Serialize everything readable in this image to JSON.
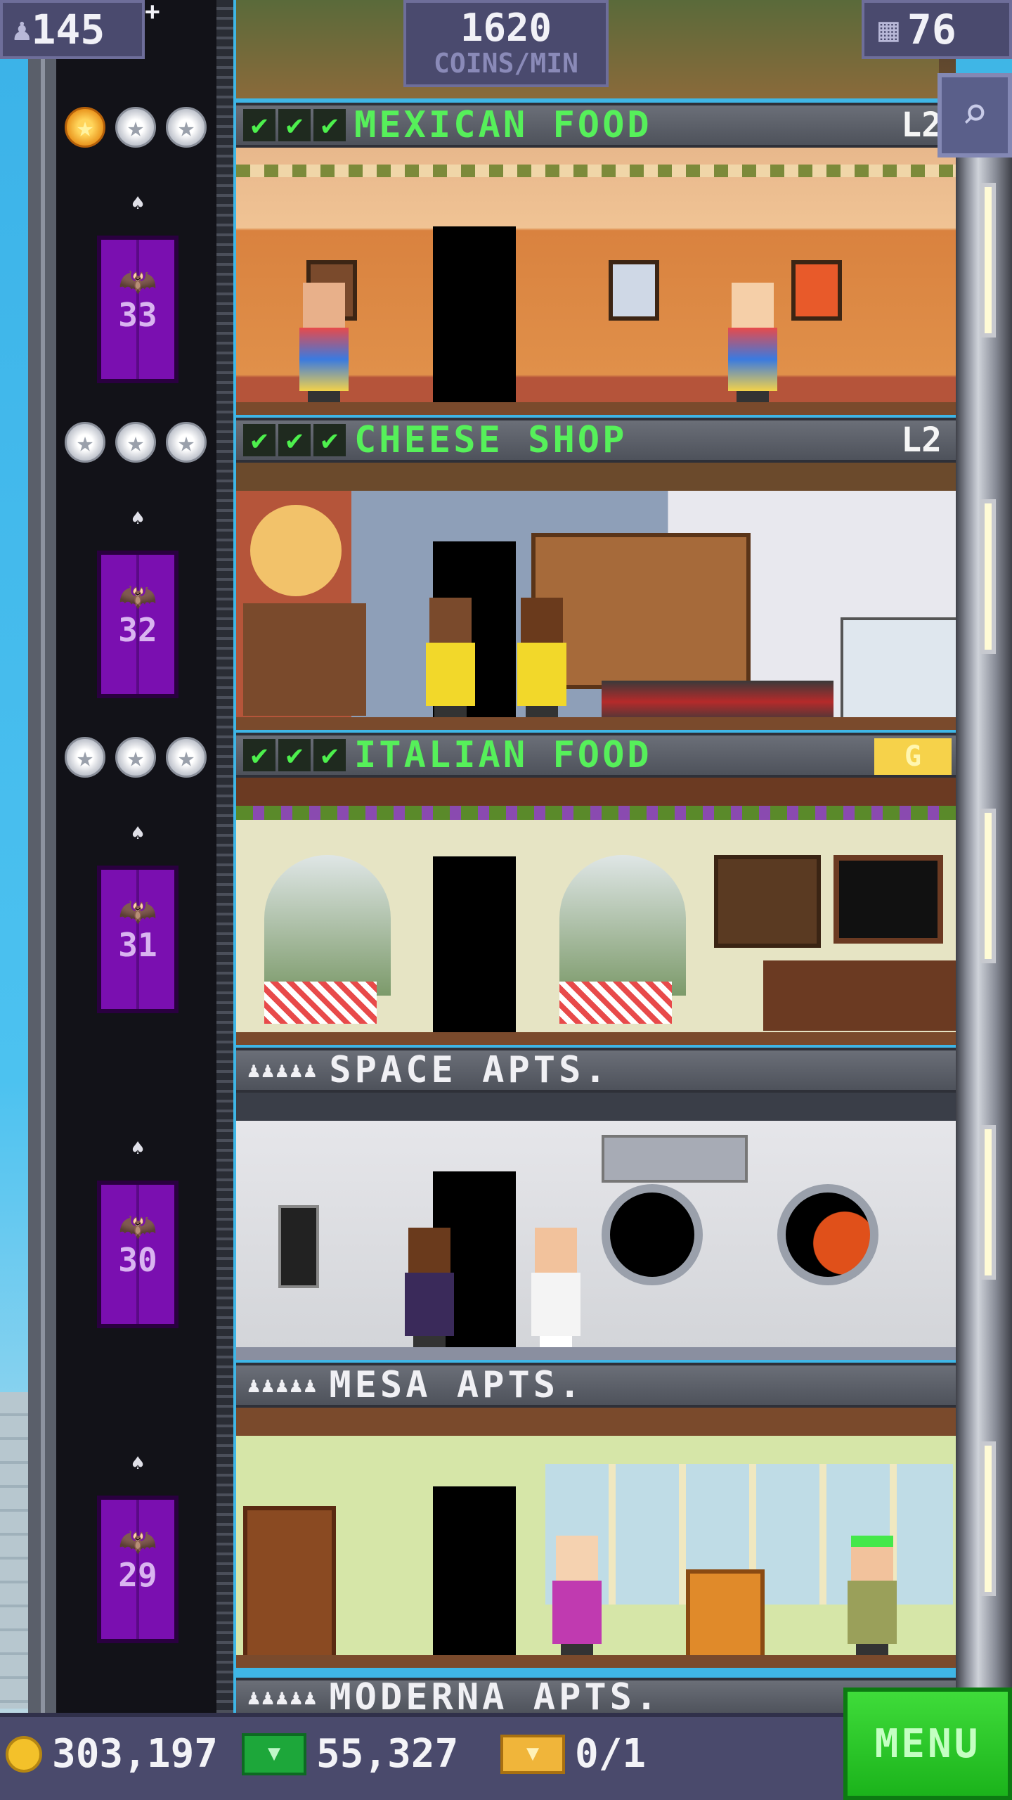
{
  "top_bar": {
    "population": "145",
    "population_plus": "+",
    "rate_value": "1620",
    "rate_label": "COINS/MIN",
    "floors_count": "76"
  },
  "floors": [
    {
      "name": "MEXICAN FOOD",
      "type": "business",
      "level": "L2",
      "checks": [
        "✔",
        "✔",
        "✔"
      ],
      "floor_number": "33",
      "stars": 3,
      "gold_stars": 1
    },
    {
      "name": "CHEESE SHOP",
      "type": "business",
      "level": "L2",
      "checks": [
        "✔",
        "✔",
        "✔"
      ],
      "floor_number": "32",
      "stars": 3,
      "gold_stars": 0
    },
    {
      "name": "ITALIAN FOOD",
      "type": "business",
      "level": "G",
      "checks": [
        "✔",
        "✔",
        "✔"
      ],
      "floor_number": "31",
      "stars": 3,
      "gold_stars": 0
    },
    {
      "name": "SPACE APTS.",
      "type": "residential",
      "floor_number": "30",
      "residents": "♟♟♟♟♟"
    },
    {
      "name": "MESA APTS.",
      "type": "residential",
      "floor_number": "29",
      "residents": "♟♟♟♟♟"
    },
    {
      "name": "MODERNA APTS.",
      "type": "residential",
      "residents": "♟♟♟♟♟"
    }
  ],
  "bottom_bar": {
    "coins": "303,197",
    "bux": "55,327",
    "tickets": "0/1",
    "menu_label": "MENU"
  },
  "icons": {
    "population": "person-icon",
    "floors": "building-icon",
    "search": "magnifier-icon",
    "coins": "coin-icon",
    "bux": "bux-icon",
    "tickets": "ticket-icon"
  },
  "colors": {
    "elevator": "#7a0fb0",
    "business_text": "#56f05a",
    "menu_button": "#2cc828",
    "gold_badge": "#f6d24a"
  }
}
